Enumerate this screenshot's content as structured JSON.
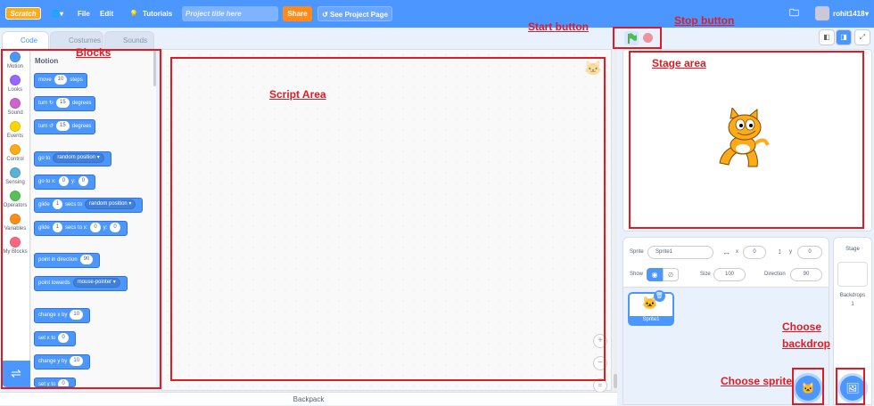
{
  "menu": {
    "logo": "Scratch",
    "file": "File",
    "edit": "Edit",
    "tutorials": "Tutorials",
    "title_placeholder": "Project title here",
    "share": "Share",
    "see_project": "See Project Page",
    "username": "rohit1418"
  },
  "tabs": {
    "code": "Code",
    "costumes": "Costumes",
    "sounds": "Sounds"
  },
  "categories": [
    {
      "label": "Motion",
      "color": "#4c97ff"
    },
    {
      "label": "Looks",
      "color": "#9966ff"
    },
    {
      "label": "Sound",
      "color": "#cf63cf"
    },
    {
      "label": "Events",
      "color": "#ffd500"
    },
    {
      "label": "Control",
      "color": "#ffab19"
    },
    {
      "label": "Sensing",
      "color": "#5cb1d6"
    },
    {
      "label": "Operators",
      "color": "#59c059"
    },
    {
      "label": "Variables",
      "color": "#ff8c1a"
    },
    {
      "label": "My Blocks",
      "color": "#ff6680"
    }
  ],
  "flyout": {
    "heading": "Motion",
    "move": {
      "a": "move",
      "v": "10",
      "b": "steps"
    },
    "turn_right": {
      "a": "turn",
      "icon": "↻",
      "v": "15",
      "b": "degrees"
    },
    "turn_left": {
      "a": "turn",
      "icon": "↺",
      "v": "15",
      "b": "degrees"
    },
    "goto": {
      "a": "go to",
      "d": "random position ▾"
    },
    "gotoxy": {
      "a": "go to x:",
      "x": "0",
      "y_label": "y:",
      "y": "0"
    },
    "glide1": {
      "a": "glide",
      "v": "1",
      "b": "secs to",
      "d": "random position ▾"
    },
    "glide2": {
      "a": "glide",
      "v": "1",
      "b": "secs to x:",
      "x": "0",
      "y_label": "y:",
      "y": "0"
    },
    "point_dir": {
      "a": "point in direction",
      "v": "90"
    },
    "point_towards": {
      "a": "point towards",
      "d": "mouse-pointer ▾"
    },
    "change_x": {
      "a": "change x by",
      "v": "10"
    },
    "set_x": {
      "a": "set x to",
      "v": "0"
    },
    "change_y": {
      "a": "change y by",
      "v": "10"
    },
    "set_y": {
      "a": "set y to",
      "v": "0"
    }
  },
  "backpack": "Backpack",
  "sprite_info": {
    "sprite_label": "Sprite",
    "sprite_name": "Sprite1",
    "x_label": "x",
    "x": "0",
    "y_label": "y",
    "y": "0",
    "show_label": "Show",
    "size_label": "Size",
    "size": "100",
    "direction_label": "Direction",
    "direction": "90"
  },
  "sprite_tile": "Sprite1",
  "stage_pane": {
    "title": "Stage",
    "backdrops_label": "Backdrops",
    "backdrops_count": "1"
  },
  "annotations": {
    "blocks": "Blocks",
    "script_area": "Script Area",
    "start_button": "Start button",
    "stop_button": "Stop button",
    "stage_area": "Stage area",
    "choose_backdrop_1": "Choose",
    "choose_backdrop_2": "backdrop",
    "choose_sprite": "Choose sprite"
  },
  "colors": {
    "menubar": "#4c97ff",
    "annotation": "#e01b24",
    "share": "#ff8c1a"
  }
}
